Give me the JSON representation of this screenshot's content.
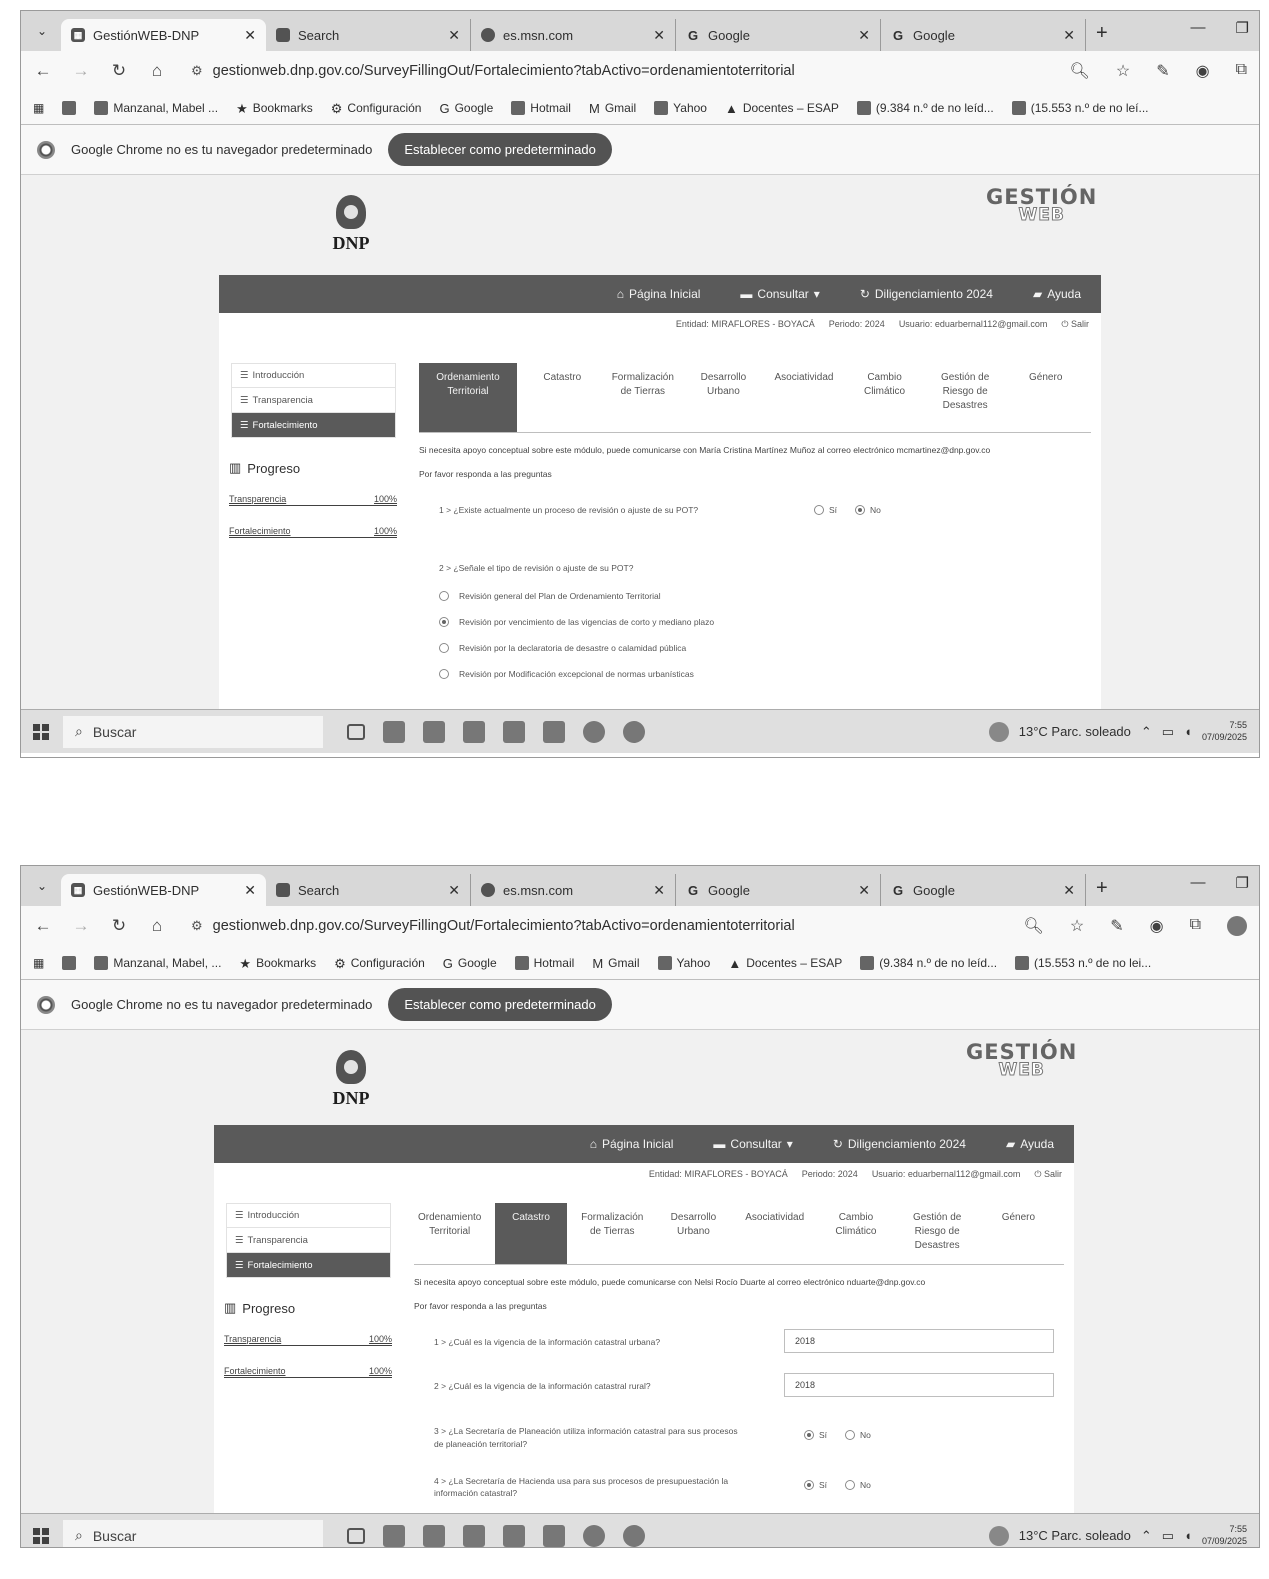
{
  "screenshots": [
    {
      "browser": {
        "tabs": [
          {
            "label": "GestiónWEB-DNP",
            "icon": "site-icon",
            "active": true
          },
          {
            "label": "Search",
            "icon": "search-favicon"
          },
          {
            "label": "es.msn.com",
            "icon": "msn-icon"
          },
          {
            "label": "Google",
            "icon": "google-icon"
          },
          {
            "label": "Google",
            "icon": "google-icon"
          }
        ],
        "url": "gestionweb.dnp.gov.co/SurveyFillingOut/Fortalecimiento?tabActivo=ordenamientoterritorial",
        "bookmarks": [
          "Manzanal, Mabel ...",
          "Bookmarks",
          "Configuración",
          "Google",
          "Hotmail",
          "Gmail",
          "Yahoo",
          "Docentes – ESAP",
          "(9.384 n.º de no leíd...",
          "(15.553 n.º de no leí..."
        ],
        "infobar_text": "Google Chrome no es tu navegador predeterminado",
        "infobar_button": "Establecer como predeterminado"
      },
      "site": {
        "dnp_logo": "DNP",
        "gw_logo_line1": "GESTIÓN",
        "gw_logo_line2": "WEB",
        "nav": [
          "Página Inicial",
          "Consultar",
          "Diligenciamiento 2024",
          "Ayuda"
        ],
        "user_info": [
          "Entidad: MIRAFLORES - BOYACÁ",
          "Periodo: 2024",
          "Usuario: eduarbernal112@gmail.com",
          "Salir"
        ],
        "sidebar": [
          "Introducción",
          "Transparencia",
          "Fortalecimiento"
        ],
        "progress_title": "Progreso",
        "progress": [
          {
            "label": "Transparencia",
            "value": "100%"
          },
          {
            "label": "Fortalecimiento",
            "value": "100%"
          }
        ],
        "subtabs": [
          "Ordenamiento Territorial",
          "Catastro",
          "Formalización de Tierras",
          "Desarrollo Urbano",
          "Asociatividad",
          "Cambio Climático",
          "Gestión de Riesgo de Desastres",
          "Género"
        ],
        "active_subtab": 0,
        "help_text": "Si necesita apoyo conceptual sobre este módulo, puede comunicarse con María Cristina Martínez Muñoz al correo electrónico mcmartinez@dnp.gov.co",
        "please_text": "Por favor responda a las preguntas",
        "q1": "1 > ¿Existe actualmente un proceso de revisión o ajuste de su POT?",
        "q1_si": "Sí",
        "q1_no": "No",
        "q2": "2 > ¿Señale el tipo de revisión o ajuste de su POT?",
        "q2_options": [
          "Revisión general del Plan de Ordenamiento Territorial",
          "Revisión por vencimiento de las vigencias de corto y mediano plazo",
          "Revisión por la declaratoria de desastre o calamidad pública",
          "Revisión por Modificación excepcional de normas urbanísticas"
        ]
      },
      "taskbar": {
        "search": "Buscar",
        "weather": "13°C  Parc. soleado",
        "time": "7:55",
        "date": "07/09/2025"
      }
    },
    {
      "browser": {
        "tabs": [
          {
            "label": "GestiónWEB-DNP",
            "icon": "site-icon",
            "active": true
          },
          {
            "label": "Search",
            "icon": "search-favicon"
          },
          {
            "label": "es.msn.com",
            "icon": "msn-icon"
          },
          {
            "label": "Google",
            "icon": "google-icon"
          },
          {
            "label": "Google",
            "icon": "google-icon"
          }
        ],
        "url": "gestionweb.dnp.gov.co/SurveyFillingOut/Fortalecimiento?tabActivo=ordenamientoterritorial",
        "bookmarks": [
          "Manzanal, Mabel, ...",
          "Bookmarks",
          "Configuración",
          "Google",
          "Hotmail",
          "Gmail",
          "Yahoo",
          "Docentes – ESAP",
          "(9.384 n.º de no leíd...",
          "(15.553 n.º de no lei..."
        ],
        "infobar_text": "Google Chrome no es tu navegador predeterminado",
        "infobar_button": "Establecer como predeterminado"
      },
      "site": {
        "dnp_logo": "DNP",
        "gw_logo_line1": "GESTIÓN",
        "gw_logo_line2": "WEB",
        "nav": [
          "Página Inicial",
          "Consultar",
          "Diligenciamiento 2024",
          "Ayuda"
        ],
        "user_info": [
          "Entidad: MIRAFLORES - BOYACÁ",
          "Periodo: 2024",
          "Usuario: eduarbernal112@gmail.com",
          "Salir"
        ],
        "sidebar": [
          "Introducción",
          "Transparencia",
          "Fortalecimiento"
        ],
        "progress_title": "Progreso",
        "progress": [
          {
            "label": "Transparencia",
            "value": "100%"
          },
          {
            "label": "Fortalecimiento",
            "value": "100%"
          }
        ],
        "subtabs": [
          "Ordenamiento Territorial",
          "Catastro",
          "Formalización de Tierras",
          "Desarrollo Urbano",
          "Asociatividad",
          "Cambio Climático",
          "Gestión de Riesgo de Desastres",
          "Género"
        ],
        "active_subtab": 1,
        "help_text": "Si necesita apoyo conceptual sobre este módulo, puede comunicarse con Nelsi Rocío Duarte al correo electrónico nduarte@dnp.gov.co",
        "please_text": "Por favor responda a las preguntas",
        "q1": "1 > ¿Cuál es la vigencia de la información catastral urbana?",
        "q1_value": "2018",
        "q2": "2 > ¿Cuál es la vigencia de la información catastral rural?",
        "q2_value": "2018",
        "q3": "3 > ¿La Secretaría de Planeación utiliza información catastral para sus procesos de planeación territorial?",
        "q4": "4 > ¿La Secretaría de Hacienda usa para sus procesos de presupuestación la información catastral?",
        "si": "Sí",
        "no": "No"
      },
      "taskbar": {
        "search": "Buscar",
        "weather": "13°C  Parc. soleado",
        "time": "7:55",
        "date": "07/09/2025"
      }
    }
  ]
}
